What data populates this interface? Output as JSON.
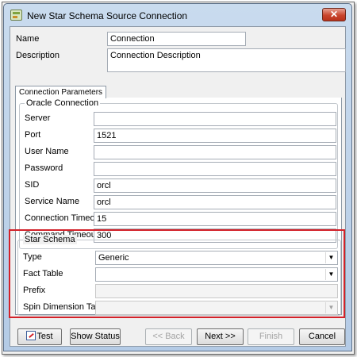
{
  "window": {
    "title": "New Star Schema Source Connection",
    "close_glyph": "✕"
  },
  "general": {
    "name_label": "Name",
    "name_value": "Connection",
    "description_label": "Description",
    "description_value": "Connection Description"
  },
  "tabs": [
    {
      "label": "Connection Parameters"
    }
  ],
  "oracle": {
    "title": "Oracle Connection",
    "fields": [
      {
        "label": "Server",
        "value": ""
      },
      {
        "label": "Port",
        "value": "1521"
      },
      {
        "label": "User Name",
        "value": ""
      },
      {
        "label": "Password",
        "value": ""
      },
      {
        "label": "SID",
        "value": "orcl"
      },
      {
        "label": "Service Name",
        "value": "orcl"
      },
      {
        "label": "Connection Timeout",
        "value": "15"
      },
      {
        "label": "Command Timeout",
        "value": "300"
      }
    ]
  },
  "star": {
    "title": "Star Schema",
    "type_label": "Type",
    "type_value": "Generic",
    "fact_label": "Fact Table",
    "fact_value": "",
    "prefix_label": "Prefix",
    "prefix_value": "",
    "spin_label": "Spin Dimension Table",
    "spin_value": ""
  },
  "buttons": {
    "test": "Test",
    "show_status": "Show Status",
    "back": "<< Back",
    "next": "Next >>",
    "finish": "Finish",
    "cancel": "Cancel"
  },
  "colors": {
    "highlight": "#d3222a",
    "title_bar": "#b4cbe6"
  },
  "icons": [
    "app-icon",
    "close-icon",
    "dropdown-arrow-icon",
    "test-icon"
  ]
}
